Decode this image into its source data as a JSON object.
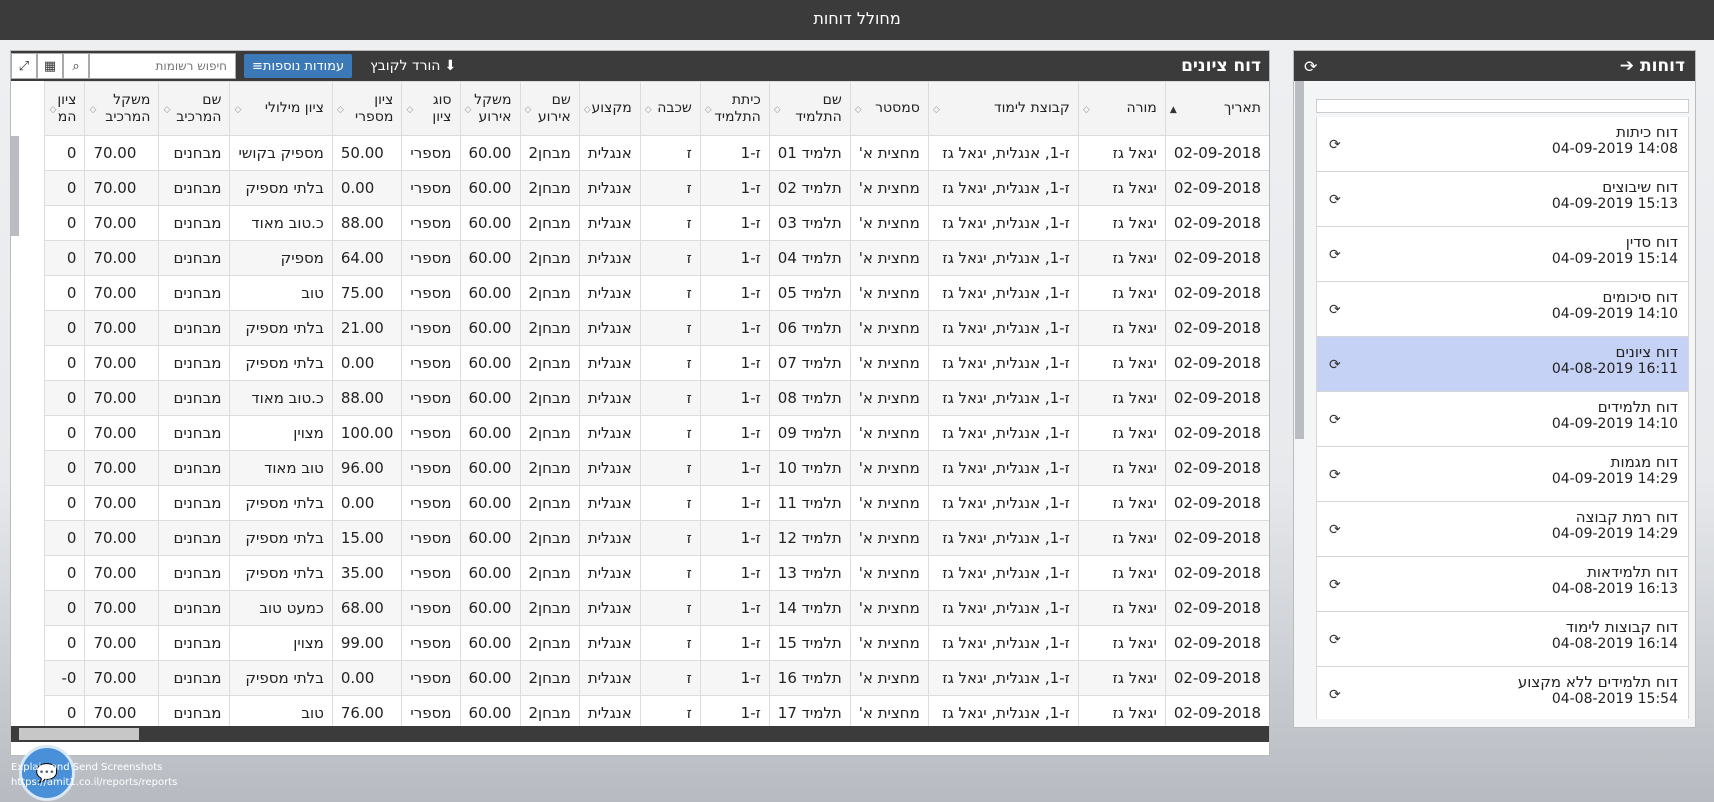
{
  "app": {
    "title": "מחולל דוחות"
  },
  "reports_panel": {
    "title": "דוחות",
    "items": [
      {
        "name": "דוח כיתות",
        "time": "14:08 04-09-2019",
        "selected": false
      },
      {
        "name": "דוח שיבוצים",
        "time": "15:13 04-09-2019",
        "selected": false
      },
      {
        "name": "דוח סדין",
        "time": "15:14 04-09-2019",
        "selected": false
      },
      {
        "name": "דוח סיכומים",
        "time": "14:10 04-09-2019",
        "selected": false
      },
      {
        "name": "דוח ציונים",
        "time": "16:11 04-08-2019",
        "selected": true
      },
      {
        "name": "דוח תלמידים",
        "time": "14:10 04-09-2019",
        "selected": false
      },
      {
        "name": "דוח מגמות",
        "time": "14:29 04-09-2019",
        "selected": false
      },
      {
        "name": "דוח רמת קבוצה",
        "time": "14:29 04-09-2019",
        "selected": false
      },
      {
        "name": "דוח תלמידאות",
        "time": "16:13 04-08-2019",
        "selected": false
      },
      {
        "name": "דוח קבוצות לימוד",
        "time": "16:14 04-08-2019",
        "selected": false
      },
      {
        "name": "דוח תלמידים ללא מקצוע",
        "time": "15:54 04-08-2019",
        "selected": false
      }
    ]
  },
  "grid": {
    "title": "דוח ציונים",
    "download_label": "הורד לקובץ",
    "columns_label": "עמודות נוספות",
    "search_placeholder": "חיפוש רשומות",
    "columns": [
      {
        "line1": "תאריך",
        "line2": ""
      },
      {
        "line1": "מורה",
        "line2": ""
      },
      {
        "line1": "קבוצת לימוד",
        "line2": ""
      },
      {
        "line1": "סמסטר",
        "line2": ""
      },
      {
        "line1": "שם",
        "line2": "התלמיד"
      },
      {
        "line1": "כיתת",
        "line2": "התלמיד"
      },
      {
        "line1": "שכבה",
        "line2": ""
      },
      {
        "line1": "מקצוע",
        "line2": ""
      },
      {
        "line1": "שם",
        "line2": "אירוע"
      },
      {
        "line1": "משקל",
        "line2": "אירוע"
      },
      {
        "line1": "סוג",
        "line2": "ציון"
      },
      {
        "line1": "ציון",
        "line2": "מספרי"
      },
      {
        "line1": "ציון מילולי",
        "line2": ""
      },
      {
        "line1": "שם",
        "line2": "המרכיב"
      },
      {
        "line1": "משקל",
        "line2": "המרכיב"
      },
      {
        "line1": "ציון",
        "line2": "המ"
      }
    ],
    "rows": [
      [
        "02-09-2018",
        "יגאל גז",
        "ז-1, אנגלית, יגאל גז",
        "מחצית א'",
        "תלמיד 01",
        "ז-1",
        "ז",
        "אנגלית",
        "מבחן2",
        "60.00",
        "מספרי",
        "50.00",
        "מספיק בקושי",
        "מבחנים",
        "70.00",
        "0"
      ],
      [
        "02-09-2018",
        "יגאל גז",
        "ז-1, אנגלית, יגאל גז",
        "מחצית א'",
        "תלמיד 02",
        "ז-1",
        "ז",
        "אנגלית",
        "מבחן2",
        "60.00",
        "מספרי",
        "0.00",
        "בלתי מספיק",
        "מבחנים",
        "70.00",
        "0"
      ],
      [
        "02-09-2018",
        "יגאל גז",
        "ז-1, אנגלית, יגאל גז",
        "מחצית א'",
        "תלמיד 03",
        "ז-1",
        "ז",
        "אנגלית",
        "מבחן2",
        "60.00",
        "מספרי",
        "88.00",
        "כ.טוב מאוד",
        "מבחנים",
        "70.00",
        "0"
      ],
      [
        "02-09-2018",
        "יגאל גז",
        "ז-1, אנגלית, יגאל גז",
        "מחצית א'",
        "תלמיד 04",
        "ז-1",
        "ז",
        "אנגלית",
        "מבחן2",
        "60.00",
        "מספרי",
        "64.00",
        "מספיק",
        "מבחנים",
        "70.00",
        "0"
      ],
      [
        "02-09-2018",
        "יגאל גז",
        "ז-1, אנגלית, יגאל גז",
        "מחצית א'",
        "תלמיד 05",
        "ז-1",
        "ז",
        "אנגלית",
        "מבחן2",
        "60.00",
        "מספרי",
        "75.00",
        "טוב",
        "מבחנים",
        "70.00",
        "0"
      ],
      [
        "02-09-2018",
        "יגאל גז",
        "ז-1, אנגלית, יגאל גז",
        "מחצית א'",
        "תלמיד 06",
        "ז-1",
        "ז",
        "אנגלית",
        "מבחן2",
        "60.00",
        "מספרי",
        "21.00",
        "בלתי מספיק",
        "מבחנים",
        "70.00",
        "0"
      ],
      [
        "02-09-2018",
        "יגאל גז",
        "ז-1, אנגלית, יגאל גז",
        "מחצית א'",
        "תלמיד 07",
        "ז-1",
        "ז",
        "אנגלית",
        "מבחן2",
        "60.00",
        "מספרי",
        "0.00",
        "בלתי מספיק",
        "מבחנים",
        "70.00",
        "0"
      ],
      [
        "02-09-2018",
        "יגאל גז",
        "ז-1, אנגלית, יגאל גז",
        "מחצית א'",
        "תלמיד 08",
        "ז-1",
        "ז",
        "אנגלית",
        "מבחן2",
        "60.00",
        "מספרי",
        "88.00",
        "כ.טוב מאוד",
        "מבחנים",
        "70.00",
        "0"
      ],
      [
        "02-09-2018",
        "יגאל גז",
        "ז-1, אנגלית, יגאל גז",
        "מחצית א'",
        "תלמיד 09",
        "ז-1",
        "ז",
        "אנגלית",
        "מבחן2",
        "60.00",
        "מספרי",
        "100.00",
        "מצוין",
        "מבחנים",
        "70.00",
        "0"
      ],
      [
        "02-09-2018",
        "יגאל גז",
        "ז-1, אנגלית, יגאל גז",
        "מחצית א'",
        "תלמיד 10",
        "ז-1",
        "ז",
        "אנגלית",
        "מבחן2",
        "60.00",
        "מספרי",
        "96.00",
        "טוב מאוד",
        "מבחנים",
        "70.00",
        "0"
      ],
      [
        "02-09-2018",
        "יגאל גז",
        "ז-1, אנגלית, יגאל גז",
        "מחצית א'",
        "תלמיד 11",
        "ז-1",
        "ז",
        "אנגלית",
        "מבחן2",
        "60.00",
        "מספרי",
        "0.00",
        "בלתי מספיק",
        "מבחנים",
        "70.00",
        "0"
      ],
      [
        "02-09-2018",
        "יגאל גז",
        "ז-1, אנגלית, יגאל גז",
        "מחצית א'",
        "תלמיד 12",
        "ז-1",
        "ז",
        "אנגלית",
        "מבחן2",
        "60.00",
        "מספרי",
        "15.00",
        "בלתי מספיק",
        "מבחנים",
        "70.00",
        "0"
      ],
      [
        "02-09-2018",
        "יגאל גז",
        "ז-1, אנגלית, יגאל גז",
        "מחצית א'",
        "תלמיד 13",
        "ז-1",
        "ז",
        "אנגלית",
        "מבחן2",
        "60.00",
        "מספרי",
        "35.00",
        "בלתי מספיק",
        "מבחנים",
        "70.00",
        "0"
      ],
      [
        "02-09-2018",
        "יגאל גז",
        "ז-1, אנגלית, יגאל גז",
        "מחצית א'",
        "תלמיד 14",
        "ז-1",
        "ז",
        "אנגלית",
        "מבחן2",
        "60.00",
        "מספרי",
        "68.00",
        "כמעט טוב",
        "מבחנים",
        "70.00",
        "0"
      ],
      [
        "02-09-2018",
        "יגאל גז",
        "ז-1, אנגלית, יגאל גז",
        "מחצית א'",
        "תלמיד 15",
        "ז-1",
        "ז",
        "אנגלית",
        "מבחן2",
        "60.00",
        "מספרי",
        "99.00",
        "מצוין",
        "מבחנים",
        "70.00",
        "0"
      ],
      [
        "02-09-2018",
        "יגאל גז",
        "ז-1, אנגלית, יגאל גז",
        "מחצית א'",
        "תלמיד 16",
        "ז-1",
        "ז",
        "אנגלית",
        "מבחן2",
        "60.00",
        "מספרי",
        "0.00",
        "בלתי מספיק",
        "מבחנים",
        "70.00",
        "0-"
      ],
      [
        "02-09-2018",
        "יגאל גז",
        "ז-1, אנגלית, יגאל גז",
        "מחצית א'",
        "תלמיד 17",
        "ז-1",
        "ז",
        "אנגלית",
        "מבחן2",
        "60.00",
        "מספרי",
        "76.00",
        "טוב",
        "מבחנים",
        "70.00",
        "0"
      ]
    ]
  },
  "footer": {
    "line1": "Explain and Send Screenshots",
    "line2": "https://amit1.co.il/reports/reports"
  }
}
